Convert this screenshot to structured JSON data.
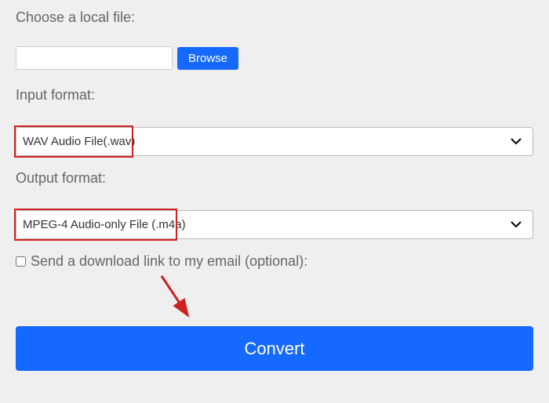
{
  "labels": {
    "choose_file": "Choose a local file:",
    "input_format": "Input format:",
    "output_format": "Output format:"
  },
  "buttons": {
    "browse": "Browse",
    "convert": "Convert"
  },
  "selects": {
    "input_format_value": "WAV Audio File(.wav)",
    "output_format_value": "MPEG-4 Audio-only File (.m4a)"
  },
  "checkbox": {
    "email_label": "Send a download link to my email (optional):"
  },
  "file_input_value": ""
}
